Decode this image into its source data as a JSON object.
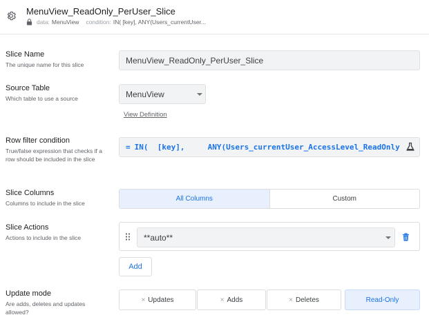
{
  "header": {
    "title": "MenuView_ReadOnly_PerUser_Slice",
    "data_key": "data:",
    "data_value": "MenuView",
    "condition_key": "condition:",
    "condition_value": "IN( [key], ANY(Users_currentUser..."
  },
  "slice_name": {
    "label": "Slice Name",
    "description": "The unique name for this slice",
    "value": "MenuView_ReadOnly_PerUser_Slice"
  },
  "source_table": {
    "label": "Source Table",
    "description": "Which table to use a source",
    "value": "MenuView",
    "view_definition": "View Definition"
  },
  "row_filter": {
    "label": "Row filter condition",
    "description": "True/false expression that checks if a row should be included in the slice",
    "eq": "=",
    "expression": "IN(  [key],     ANY(Users_currentUser_AccessLevel_ReadOnly"
  },
  "slice_columns": {
    "label": "Slice Columns",
    "description": "Columns to include in the slice",
    "options": [
      "All Columns",
      "Custom"
    ],
    "selected": "All Columns"
  },
  "slice_actions": {
    "label": "Slice Actions",
    "description": "Actions to include in the slice",
    "value": "**auto**",
    "add_label": "Add"
  },
  "update_mode": {
    "label": "Update mode",
    "description": "Are adds, deletes and updates allowed?",
    "options": [
      "Updates",
      "Adds",
      "Deletes",
      "Read-Only"
    ],
    "selected": "Read-Only",
    "x": "×"
  },
  "colors": {
    "accent": "#1a73e8",
    "selected_bg": "#e8f0fe",
    "field_bg": "#f1f3f4"
  },
  "icons": {
    "header": "gear-icon",
    "meta": "lock-icon",
    "expression": "flask-icon",
    "action_drag": "drag-handle-icon",
    "action_delete": "trash-icon"
  }
}
